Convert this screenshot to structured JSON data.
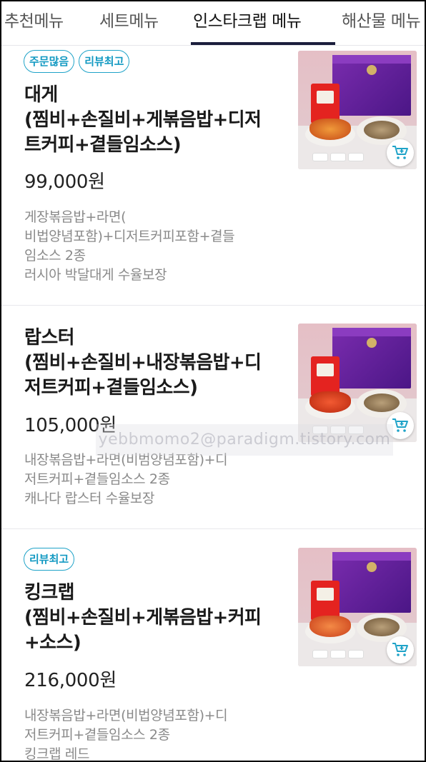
{
  "tabs": [
    "추천메뉴",
    "세트메뉴",
    "인스타크랩 메뉴",
    "해산물 메뉴"
  ],
  "active_tab_index": 2,
  "colors": {
    "accent": "#1fa3c8",
    "tab_indicator": "#1b1e3c",
    "box_purple": "#6a22a0",
    "noodle_red": "#e42320"
  },
  "watermark_text": "yebbmomo2@paradigm.tistory.com",
  "items": [
    {
      "badges": [
        "주문많음",
        "리뷰최고"
      ],
      "name": "대게\n(찜비+손질비+게볶음밥+디저트커피+곁들임소스)",
      "name_lines": [
        "대게",
        "(찜비+손질비+게볶음밥+디저",
        "트커피+곁들임소스)"
      ],
      "price": "99,000원",
      "desc_lines": [
        "게장볶음밥+라면(",
        "비법양념포함)+디저트커피포함+곁들",
        "임소스 2종",
        "러시아 박달대게 수율보장"
      ],
      "image_icon": "crab-set-photo",
      "cart_icon": "cart-add-icon"
    },
    {
      "badges": [],
      "name_lines": [
        "랍스터",
        "(찜비+손질비+내장볶음밥+디",
        "저트커피+곁들임소스)"
      ],
      "price": "105,000원",
      "desc_lines": [
        "내장볶음밥+라면(비범양념포함)+디",
        "저트커피+곁들임소스 2종",
        "캐나다 랍스터 수율보장"
      ],
      "image_icon": "lobster-set-photo",
      "cart_icon": "cart-add-icon"
    },
    {
      "badges": [
        "리뷰최고"
      ],
      "name_lines": [
        "킹크랩",
        "(찜비+손질비+게볶음밥+커피",
        "+소스)"
      ],
      "price": "216,000원",
      "desc_lines": [
        "내장볶음밥+라면(비법양념포함)+디",
        "저트커피+곁들임소스 2종",
        "킹크랩 레드"
      ],
      "image_icon": "kingcrab-set-photo",
      "cart_icon": "cart-add-icon"
    }
  ]
}
